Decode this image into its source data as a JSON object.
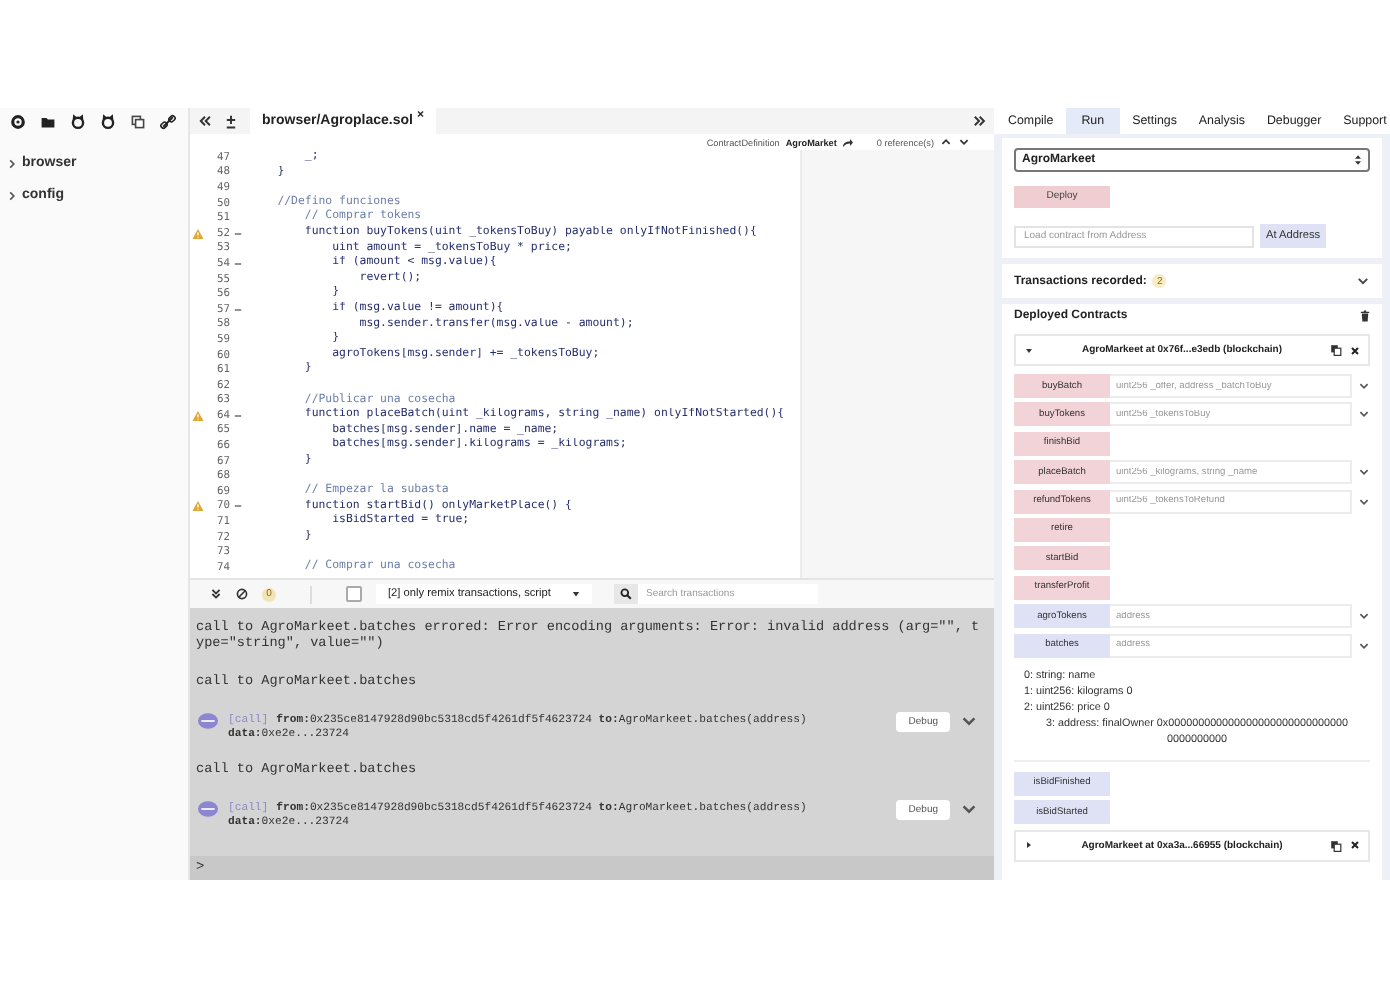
{
  "file_explorer": {
    "items": [
      {
        "label": "browser",
        "expanded": false
      },
      {
        "label": "config",
        "expanded": false
      }
    ]
  },
  "editor": {
    "tab": {
      "title": "browser/Agroplace.sol",
      "close": "×"
    },
    "context": {
      "type_label": "ContractDefinition",
      "name": "AgroMarket",
      "references": "0 reference(s)"
    },
    "lines": [
      {
        "number": "47",
        "text": "        _;",
        "kind": "code",
        "warning": false,
        "foldable": false
      },
      {
        "number": "48",
        "text": "    }",
        "kind": "code",
        "warning": false,
        "foldable": false
      },
      {
        "number": "49",
        "kind": "code",
        "warning": false,
        "foldable": false
      },
      {
        "number": "50",
        "text": "    //Defino funciones",
        "kind": "comment",
        "warning": false,
        "foldable": false
      },
      {
        "number": "51",
        "text": "        // Comprar tokens",
        "kind": "comment",
        "warning": false,
        "foldable": false
      },
      {
        "number": "52",
        "text": "        function buyTokens(uint _tokensToBuy) payable onlyIfNotFinished(){",
        "kind": "code",
        "warning": true,
        "foldable": true
      },
      {
        "number": "53",
        "text": "            uint amount = _tokensToBuy * price;",
        "kind": "code",
        "warning": false,
        "foldable": false
      },
      {
        "number": "54",
        "text": "            if (amount < msg.value){",
        "kind": "code",
        "warning": false,
        "foldable": true
      },
      {
        "number": "55",
        "text": "                revert();",
        "kind": "code",
        "warning": false,
        "foldable": false
      },
      {
        "number": "56",
        "text": "            }",
        "kind": "code",
        "warning": false,
        "foldable": false
      },
      {
        "number": "57",
        "text": "            if (msg.value != amount){",
        "kind": "code",
        "warning": false,
        "foldable": true
      },
      {
        "number": "58",
        "text": "                msg.sender.transfer(msg.value - amount);",
        "kind": "code",
        "warning": false,
        "foldable": false
      },
      {
        "number": "59",
        "text": "            }",
        "kind": "code",
        "warning": false,
        "foldable": false
      },
      {
        "number": "60",
        "text": "            agroTokens[msg.sender] += _tokensToBuy;",
        "kind": "code",
        "warning": false,
        "foldable": false
      },
      {
        "number": "61",
        "text": "        }",
        "kind": "code",
        "warning": false,
        "foldable": false
      },
      {
        "number": "62",
        "kind": "code",
        "warning": false,
        "foldable": false
      },
      {
        "number": "63",
        "text": "        //Publicar una cosecha",
        "kind": "comment",
        "warning": false,
        "foldable": false
      },
      {
        "number": "64",
        "text": "        function placeBatch(uint _kilograms, string _name) onlyIfNotStarted(){",
        "kind": "code",
        "warning": true,
        "foldable": true
      },
      {
        "number": "65",
        "text": "            batches[msg.sender].name = _name;",
        "kind": "code",
        "warning": false,
        "foldable": false
      },
      {
        "number": "66",
        "text": "            batches[msg.sender].kilograms = _kilograms;",
        "kind": "code",
        "warning": false,
        "foldable": false
      },
      {
        "number": "67",
        "text": "        }",
        "kind": "code",
        "warning": false,
        "foldable": false
      },
      {
        "number": "68",
        "kind": "code",
        "warning": false,
        "foldable": false
      },
      {
        "number": "69",
        "text": "        // Empezar la subasta",
        "kind": "comment",
        "warning": false,
        "foldable": false
      },
      {
        "number": "70",
        "text": "        function startBid() onlyMarketPlace() {",
        "kind": "code",
        "warning": true,
        "foldable": true
      },
      {
        "number": "71",
        "text": "            isBidStarted = true;",
        "kind": "code",
        "warning": false,
        "foldable": false
      },
      {
        "number": "72",
        "text": "        }",
        "kind": "code",
        "warning": false,
        "foldable": false
      },
      {
        "number": "73",
        "kind": "code",
        "warning": false,
        "foldable": false
      },
      {
        "number": "74",
        "text": "        // Comprar una cosecha",
        "kind": "comment",
        "warning": false,
        "foldable": false
      }
    ]
  },
  "terminal": {
    "pending_count": "0",
    "filter_checked": false,
    "filter": "[2] only remix transactions, script",
    "search_placeholder": "Search transactions",
    "entries": [
      {
        "kind": "message",
        "text": "call to AgroMarkeet.batches errored: Error encoding arguments: Error: invalid address (arg=\"\", type=\"string\", value=\"\")"
      },
      {
        "kind": "message",
        "text": "call to AgroMarkeet.batches"
      },
      {
        "kind": "call",
        "tag": "[call]",
        "summary": "**from:**0x235ce8147928d90bc5318cd5f4261df5f4623724 **to:**AgroMarkeet.batches(address)",
        "data": "**data:**0xe2e...23724",
        "button": "Debug",
        "expanded": false
      },
      {
        "kind": "message",
        "text": "call to AgroMarkeet.batches"
      },
      {
        "kind": "call",
        "tag": "[call]",
        "summary": "**from:**0x235ce8147928d90bc5318cd5f4261df5f4623724 **to:**AgroMarkeet.batches(address)",
        "data": "**data:**0xe2e...23724",
        "button": "Debug",
        "expanded": false
      }
    ],
    "prompt": ">"
  },
  "right_panel": {
    "tabs": [
      {
        "label": "Compile",
        "selected": false
      },
      {
        "label": "Run",
        "selected": true
      },
      {
        "label": "Settings",
        "selected": false
      },
      {
        "label": "Analysis",
        "selected": false
      },
      {
        "label": "Debugger",
        "selected": false
      },
      {
        "label": "Support",
        "selected": false
      }
    ],
    "run": {
      "contract": "AgroMarkeet",
      "deploy": "Deploy",
      "address_placeholder": "Load contract from Address",
      "at_address": "At Address",
      "transactions_label": "Transactions recorded:",
      "transactions_count": "2",
      "deployed_title": "Deployed Contracts",
      "instances": [
        {
          "title": "AgroMarkeet at 0x76f...e3edb (blockchain)",
          "expanded": true,
          "functions": [
            {
              "name": "buyBatch",
              "kind": "transact",
              "placeholder": "uint256 _offer, address _batchToBuy"
            },
            {
              "name": "buyTokens",
              "kind": "transact",
              "placeholder": "uint256 _tokensToBuy"
            },
            {
              "name": "finishBid",
              "kind": "transact"
            },
            {
              "name": "placeBatch",
              "kind": "transact",
              "placeholder": "uint256 _kilograms, string _name"
            },
            {
              "name": "refundTokens",
              "kind": "transact",
              "placeholder": "uint256 _tokensToRefund"
            },
            {
              "name": "retire",
              "kind": "transact"
            },
            {
              "name": "startBid",
              "kind": "transact"
            },
            {
              "name": "transferProfit",
              "kind": "transact"
            },
            {
              "name": "agroTokens",
              "kind": "call",
              "placeholder": "address"
            },
            {
              "name": "batches",
              "kind": "call",
              "placeholder": "address",
              "outputs": [
                "0: string: name",
                "1: uint256: kilograms 0",
                "2: uint256: price 0",
                "3: address: finalOwner 0x0000000000000000000000000000000000000000"
              ]
            },
            {
              "name": "isBidFinished",
              "kind": "call"
            },
            {
              "name": "isBidStarted",
              "kind": "call"
            }
          ]
        },
        {
          "title": "AgroMarkeet at 0xa3a...66955 (blockchain)",
          "expanded": false
        }
      ]
    }
  }
}
